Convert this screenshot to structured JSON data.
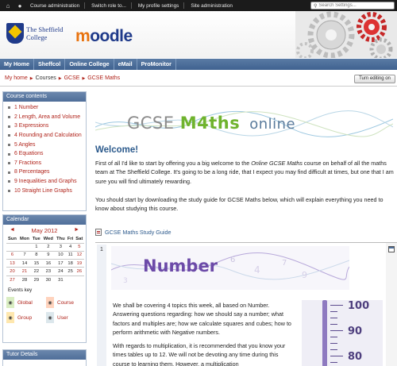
{
  "topbar": {
    "items": [
      "Course administration",
      "Switch role to...",
      "My profile settings",
      "Site administration"
    ],
    "search_placeholder": "Search Settings..."
  },
  "header": {
    "college_line1": "The Sheffield",
    "college_line2": "College",
    "moodle_logo": "moodle"
  },
  "nav": {
    "items": [
      "My Home",
      "Sheffcol",
      "Online College",
      "eMail",
      "ProMonitor"
    ]
  },
  "breadcrumb": [
    "My home",
    "Courses",
    "GCSE",
    "GCSE Maths"
  ],
  "edit_button": "Turn editing on",
  "course_contents": {
    "title": "Course contents",
    "items": [
      "1 Number",
      "2 Length, Area and Volume",
      "3 Expressions",
      "4 Rounding and Calculation",
      "5 Angles",
      "6 Equations",
      "7 Fractions",
      "8 Percentages",
      "9 Inequalities and Graphs",
      "10 Straight Line Graphs"
    ]
  },
  "calendar": {
    "title": "Calendar",
    "month": "May 2012",
    "prev": "◄",
    "next": "►",
    "days": [
      "Sun",
      "Mon",
      "Tue",
      "Wed",
      "Thu",
      "Fri",
      "Sat"
    ],
    "weeks": [
      [
        "",
        "",
        "1",
        "2",
        "3",
        "4",
        "5"
      ],
      [
        "6",
        "7",
        "8",
        "9",
        "10",
        "11",
        "12"
      ],
      [
        "13",
        "14",
        "15",
        "16",
        "17",
        "18",
        "19"
      ],
      [
        "20",
        "21",
        "22",
        "23",
        "24",
        "25",
        "26"
      ],
      [
        "27",
        "28",
        "29",
        "30",
        "31",
        "",
        ""
      ]
    ]
  },
  "events_key": {
    "title": "Events key",
    "items": [
      {
        "label": "Global",
        "color": "#d9edc2"
      },
      {
        "label": "Course",
        "color": "#ffd3bd"
      },
      {
        "label": "Group",
        "color": "#fee7ae"
      },
      {
        "label": "User",
        "color": "#dce7ec"
      }
    ]
  },
  "tutor_details": "Tutor Details",
  "main": {
    "banner_left": "GCSE ",
    "banner_maths": "M4ths",
    "banner_right": "online",
    "welcome": "Welcome!",
    "para1_a": "First of all I'd like to start by offering you a big welcome to the ",
    "para1_em": "Online GCSE Maths",
    "para1_b": " course on behalf of all the maths team at The Sheffield College. It's going to be a long ride, that I expect you may find difficult at times, but one that I am sure you will find ultimately rewarding.",
    "para2": "You should start by downloading the study guide for GCSE Maths below, which will explain everything you need to know about studying this course.",
    "guide_link": "GCSE Maths Study Guide",
    "section_number": "1",
    "section_banner": "Number",
    "sec_para1": "We shall be covering 4 topics this week, all based on Number. Answering questions regarding: how we should say a number; what factors and multiples are; how we calculate squares and cubes; how to perform arithmetic with Negative numbers.",
    "sec_para2": "With regards to multiplication, it is recommended that you know your times tables up to 12.  We will not be devoting any time during this course to learning them.  However, a multiplication",
    "thermo_labels": [
      "100",
      "90",
      "80"
    ]
  },
  "colors": {
    "accent_link": "#b0231a",
    "nav_blue": "#4f6e99",
    "heading_blue": "#2c5a8c"
  }
}
